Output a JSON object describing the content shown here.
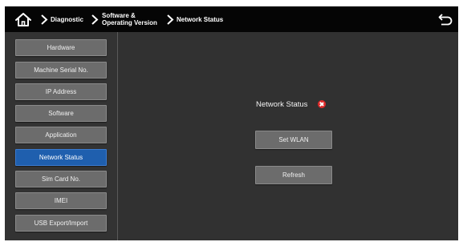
{
  "header": {
    "home_icon": "home-icon",
    "breadcrumb": [
      "Diagnostic",
      "Software & Operating Version",
      "Network Status"
    ],
    "breadcrumb_software_line1": "Software &",
    "breadcrumb_software_line2": "Operating Version",
    "back_icon": "back-arrow-icon"
  },
  "sidebar": {
    "items": [
      {
        "label": "Hardware"
      },
      {
        "label": "Machine Serial No."
      },
      {
        "label": "IP Address"
      },
      {
        "label": "Software"
      },
      {
        "label": "Application"
      },
      {
        "label": "Network Status",
        "active": true
      },
      {
        "label": "Sim Card No."
      },
      {
        "label": "IMEI"
      },
      {
        "label": "USB Export/Import"
      }
    ]
  },
  "main": {
    "status_label": "Network Status",
    "status_icon": "error-x-icon",
    "status_color": "#e02a2a",
    "set_wlan_label": "Set WLAN",
    "refresh_label": "Refresh"
  },
  "colors": {
    "header_bg": "#050505",
    "panel_bg": "#313131",
    "button_bg": "#6c6c6c",
    "active_bg": "#1f5fae"
  }
}
